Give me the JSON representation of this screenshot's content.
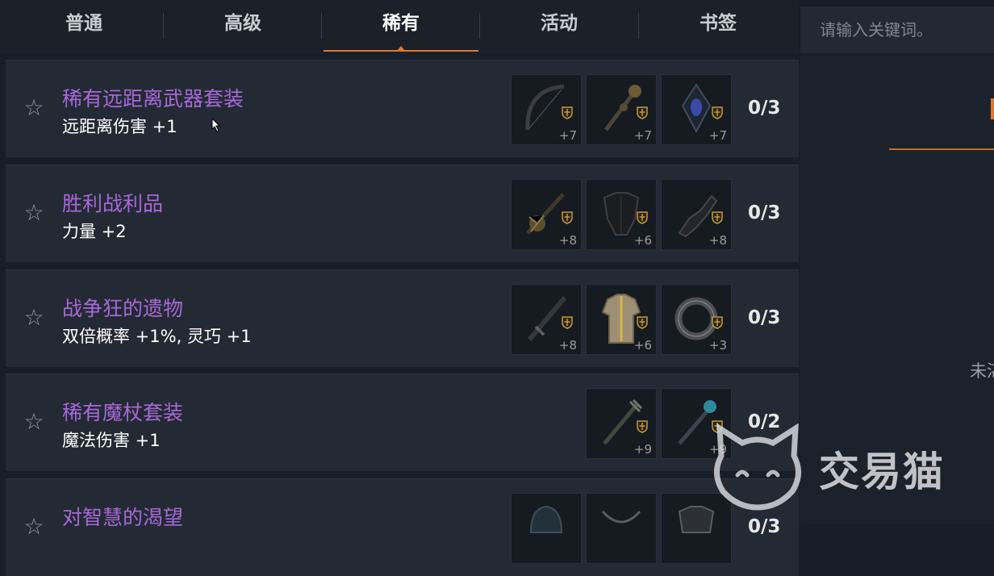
{
  "tabs": [
    {
      "label": "普通"
    },
    {
      "label": "高级"
    },
    {
      "label": "稀有"
    },
    {
      "label": "活动"
    },
    {
      "label": "书签"
    }
  ],
  "active_tab": "稀有",
  "search": {
    "placeholder": "请输入关键词。"
  },
  "right_panel": {
    "partial_text": "未湛"
  },
  "sets": [
    {
      "title": "稀有远距离武器套装",
      "bonus": "远距离伤害 +1",
      "count": "0/3",
      "items": [
        {
          "icon": "bow-icon",
          "level": "+7"
        },
        {
          "icon": "mace-icon",
          "level": "+7"
        },
        {
          "icon": "amulet-icon",
          "level": "+7"
        }
      ]
    },
    {
      "title": "胜利战利品",
      "bonus": "力量 +2",
      "count": "0/3",
      "items": [
        {
          "icon": "spiked-mace-icon",
          "level": "+8"
        },
        {
          "icon": "chest-armor-icon",
          "level": "+6"
        },
        {
          "icon": "gauntlet-icon",
          "level": "+8"
        }
      ]
    },
    {
      "title": "战争狂的遗物",
      "bonus": "双倍概率 +1%, 灵巧 +1",
      "count": "0/3",
      "items": [
        {
          "icon": "sword-icon",
          "level": "+8"
        },
        {
          "icon": "robe-icon",
          "level": "+6"
        },
        {
          "icon": "ring-icon",
          "level": "+3"
        }
      ]
    },
    {
      "title": "稀有魔杖套装",
      "bonus": "魔法伤害 +1",
      "count": "0/2",
      "items": [
        {
          "icon": "staff-icon",
          "level": "+9"
        },
        {
          "icon": "wand-icon",
          "level": "+9"
        }
      ]
    },
    {
      "title": "对智慧的渴望",
      "bonus": "",
      "count": "0/3",
      "items": [
        {
          "icon": "helmet-icon",
          "level": ""
        },
        {
          "icon": "necklace-icon",
          "level": ""
        },
        {
          "icon": "armor-icon",
          "level": ""
        }
      ]
    }
  ],
  "watermark": {
    "text": "交易猫"
  },
  "colors": {
    "accent": "#e0782e",
    "title": "#a768d8",
    "background": "#181e27"
  }
}
